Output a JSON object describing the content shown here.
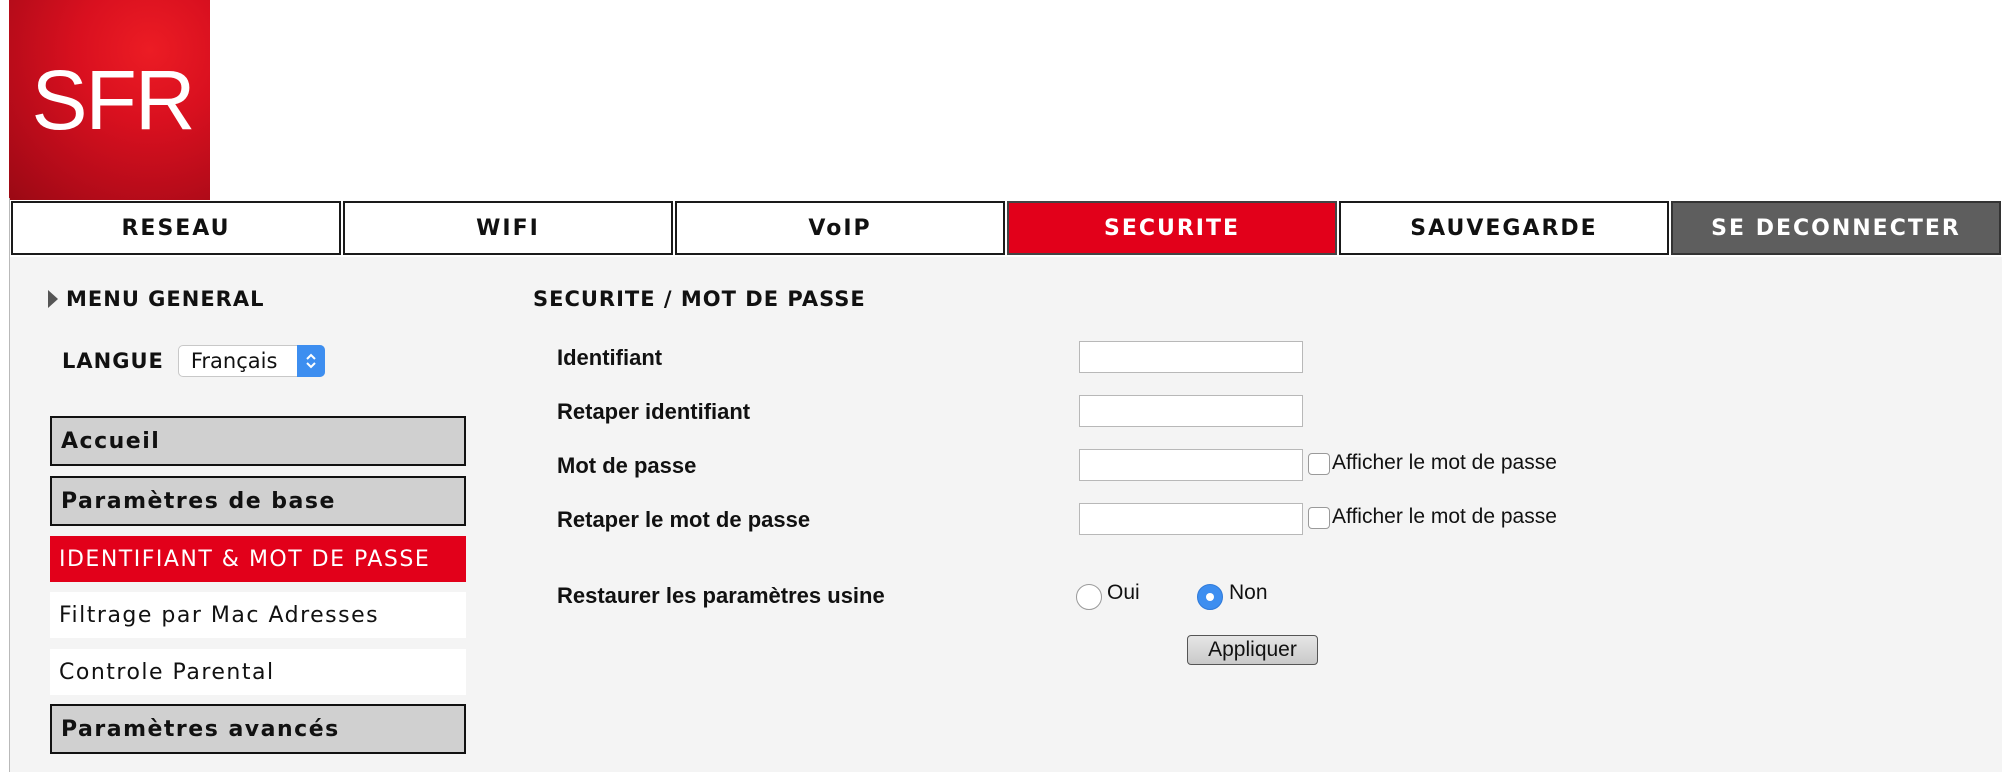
{
  "brand": {
    "logo_text": "SFR",
    "primary_color": "#e2001a",
    "dark_tab_color": "#5e5e5e"
  },
  "nav": {
    "tabs": [
      {
        "label": "RESEAU",
        "state": "normal"
      },
      {
        "label": "WIFI",
        "state": "normal"
      },
      {
        "label": "VoIP",
        "state": "normal"
      },
      {
        "label": "SECURITE",
        "state": "active"
      },
      {
        "label": "SAUVEGARDE",
        "state": "normal"
      },
      {
        "label": "SE DECONNECTER",
        "state": "dark"
      }
    ]
  },
  "sidebar": {
    "menu_title": "MENU GENERAL",
    "language": {
      "label": "LANGUE",
      "selected": "Français"
    },
    "items": [
      {
        "label": "Accueil",
        "kind": "section"
      },
      {
        "label": "Paramètres de base",
        "kind": "section"
      },
      {
        "label": "IDENTIFIANT & MOT DE PASSE",
        "kind": "active"
      },
      {
        "label": "Filtrage par Mac Adresses",
        "kind": "plain"
      },
      {
        "label": "Controle Parental",
        "kind": "plain"
      },
      {
        "label": "Paramètres avancés",
        "kind": "section"
      }
    ]
  },
  "main": {
    "title": "SECURITE / MOT DE PASSE",
    "fields": [
      {
        "label": "Identifiant",
        "value": ""
      },
      {
        "label": "Retaper identifiant",
        "value": ""
      },
      {
        "label": "Mot de passe",
        "value": "",
        "show_password_label": "Afficher le mot de passe",
        "show_password_checked": false
      },
      {
        "label": "Retaper le mot de passe",
        "value": "",
        "show_password_label": "Afficher le mot de passe",
        "show_password_checked": false
      }
    ],
    "factory_reset": {
      "label": "Restaurer les paramètres usine",
      "options": [
        {
          "label": "Oui",
          "selected": false
        },
        {
          "label": "Non",
          "selected": true
        }
      ]
    },
    "apply_label": "Appliquer"
  }
}
